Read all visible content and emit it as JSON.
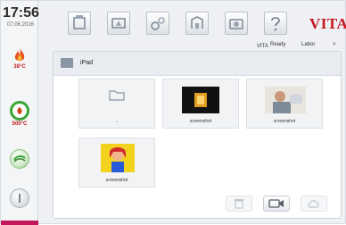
{
  "status": {
    "time": "17:56",
    "date": "07.06.2016"
  },
  "sidebar": {
    "temp1": "38°C",
    "temp2": "500°C",
    "colors": {
      "flame": "#e23a1b",
      "accent": "#c41a1a",
      "green": "#3aa635"
    }
  },
  "toolbar": {
    "icons": [
      "program-icon",
      "firing-icon",
      "settings-icon",
      "vacuum-icon",
      "camera-icon",
      "help-icon"
    ]
  },
  "brand": {
    "logo": "VITA"
  },
  "status_bar": {
    "state": "VITA",
    "ready": "Ready",
    "labor": "Labor"
  },
  "browser": {
    "folder_name": "iPad",
    "items": [
      {
        "name": "..",
        "type": "folder"
      },
      {
        "name": "screenshot",
        "type": "image"
      },
      {
        "name": "screenshot",
        "type": "image"
      },
      {
        "name": "screenshot",
        "type": "image"
      }
    ]
  }
}
